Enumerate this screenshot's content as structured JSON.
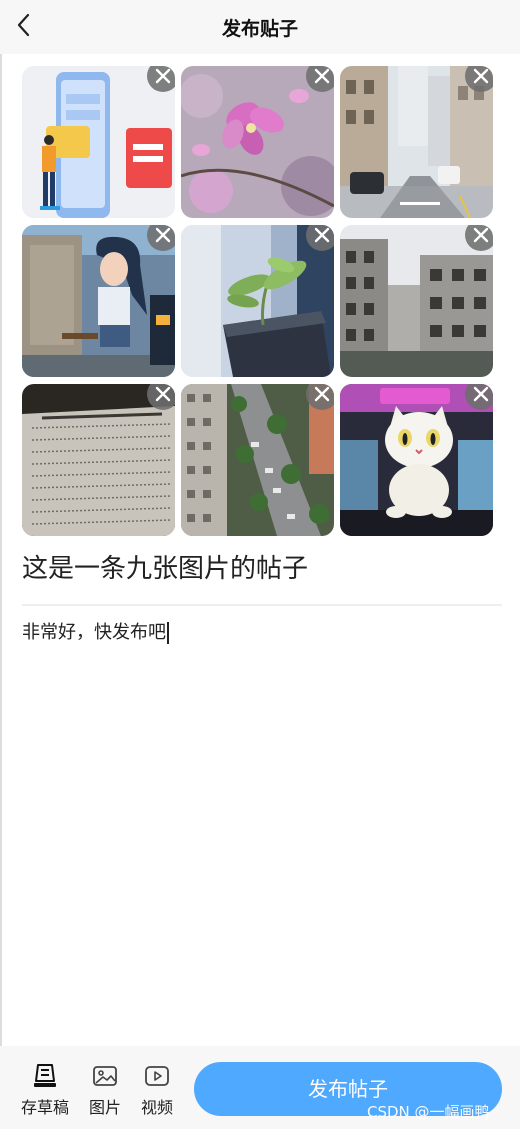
{
  "header": {
    "title": "发布贴子",
    "back_icon": "chevron-left-icon"
  },
  "images": [
    {
      "alt": "illustration-phone-card"
    },
    {
      "alt": "pink-flower"
    },
    {
      "alt": "street-buildings"
    },
    {
      "alt": "anime-mural-girl"
    },
    {
      "alt": "plant-sprout"
    },
    {
      "alt": "old-building"
    },
    {
      "alt": "document-text"
    },
    {
      "alt": "aerial-street"
    },
    {
      "alt": "white-cat-plush"
    }
  ],
  "remove_icon": "close-icon",
  "post": {
    "title": "这是一条九张图片的帖子",
    "body": "非常好，快发布吧"
  },
  "toolbar": {
    "draft_label": "存草稿",
    "image_label": "图片",
    "video_label": "视频",
    "publish_label": "发布帖子"
  },
  "watermark": "CSDN @一幅画鸭",
  "colors": {
    "accent": "#4ea9ff",
    "header_bg": "#f7f7f7"
  }
}
